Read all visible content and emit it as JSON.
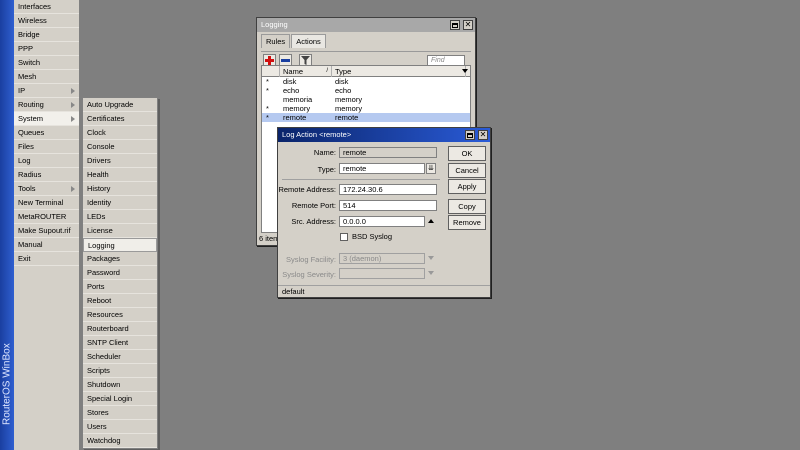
{
  "brand": {
    "vertical_text": "RouterOS WinBox",
    "strip_color": "#2a52c0"
  },
  "main_menu": [
    {
      "label": "Interfaces"
    },
    {
      "label": "Wireless"
    },
    {
      "label": "Bridge"
    },
    {
      "label": "PPP"
    },
    {
      "label": "Switch"
    },
    {
      "label": "Mesh"
    },
    {
      "label": "IP",
      "submenu": true
    },
    {
      "label": "Routing",
      "submenu": true
    },
    {
      "label": "System",
      "submenu": true,
      "active": true
    },
    {
      "label": "Queues"
    },
    {
      "label": "Files"
    },
    {
      "label": "Log"
    },
    {
      "label": "Radius"
    },
    {
      "label": "Tools",
      "submenu": true
    },
    {
      "label": "New Terminal"
    },
    {
      "label": "MetaROUTER"
    },
    {
      "label": "Make Supout.rif"
    },
    {
      "label": "Manual"
    },
    {
      "label": "Exit"
    }
  ],
  "system_submenu": [
    "Auto Upgrade",
    "Certificates",
    "Clock",
    "Console",
    "Drivers",
    "Health",
    "History",
    "Identity",
    "LEDs",
    "License",
    "Logging",
    "Packages",
    "Password",
    "Ports",
    "Reboot",
    "Resources",
    "Routerboard",
    "SNTP Client",
    "Scheduler",
    "Scripts",
    "Shutdown",
    "Special Login",
    "Stores",
    "Users",
    "Watchdog"
  ],
  "system_submenu_selected": "Logging",
  "logging_window": {
    "title": "Logging",
    "tabs": [
      "Rules",
      "Actions"
    ],
    "active_tab": "Actions",
    "find_placeholder": "Find",
    "columns": [
      "Name",
      "Type"
    ],
    "rows": [
      {
        "flag": "*",
        "name": "disk",
        "type": "disk"
      },
      {
        "flag": "*",
        "name": "echo",
        "type": "echo"
      },
      {
        "flag": "",
        "name": "memoria",
        "type": "memory"
      },
      {
        "flag": "*",
        "name": "memory",
        "type": "memory"
      },
      {
        "flag": "*",
        "name": "remote",
        "type": "remote",
        "selected": true
      }
    ],
    "status": "6 item"
  },
  "log_action_dialog": {
    "title": "Log Action <remote>",
    "fields": {
      "name": {
        "label": "Name:",
        "value": "remote"
      },
      "type": {
        "label": "Type:",
        "value": "remote"
      },
      "remote_address": {
        "label": "Remote Address:",
        "value": "172.24.30.6"
      },
      "remote_port": {
        "label": "Remote Port:",
        "value": "514"
      },
      "src_address": {
        "label": "Src. Address:",
        "value": "0.0.0.0"
      },
      "bsd_syslog": {
        "label": "BSD Syslog",
        "checked": false
      },
      "syslog_facility": {
        "label": "Syslog Facility:",
        "value": "3 (daemon)"
      },
      "syslog_severity": {
        "label": "Syslog Severity:",
        "value": ""
      }
    },
    "buttons": {
      "ok": "OK",
      "cancel": "Cancel",
      "apply": "Apply",
      "copy": "Copy",
      "remove": "Remove"
    },
    "status": "default"
  }
}
